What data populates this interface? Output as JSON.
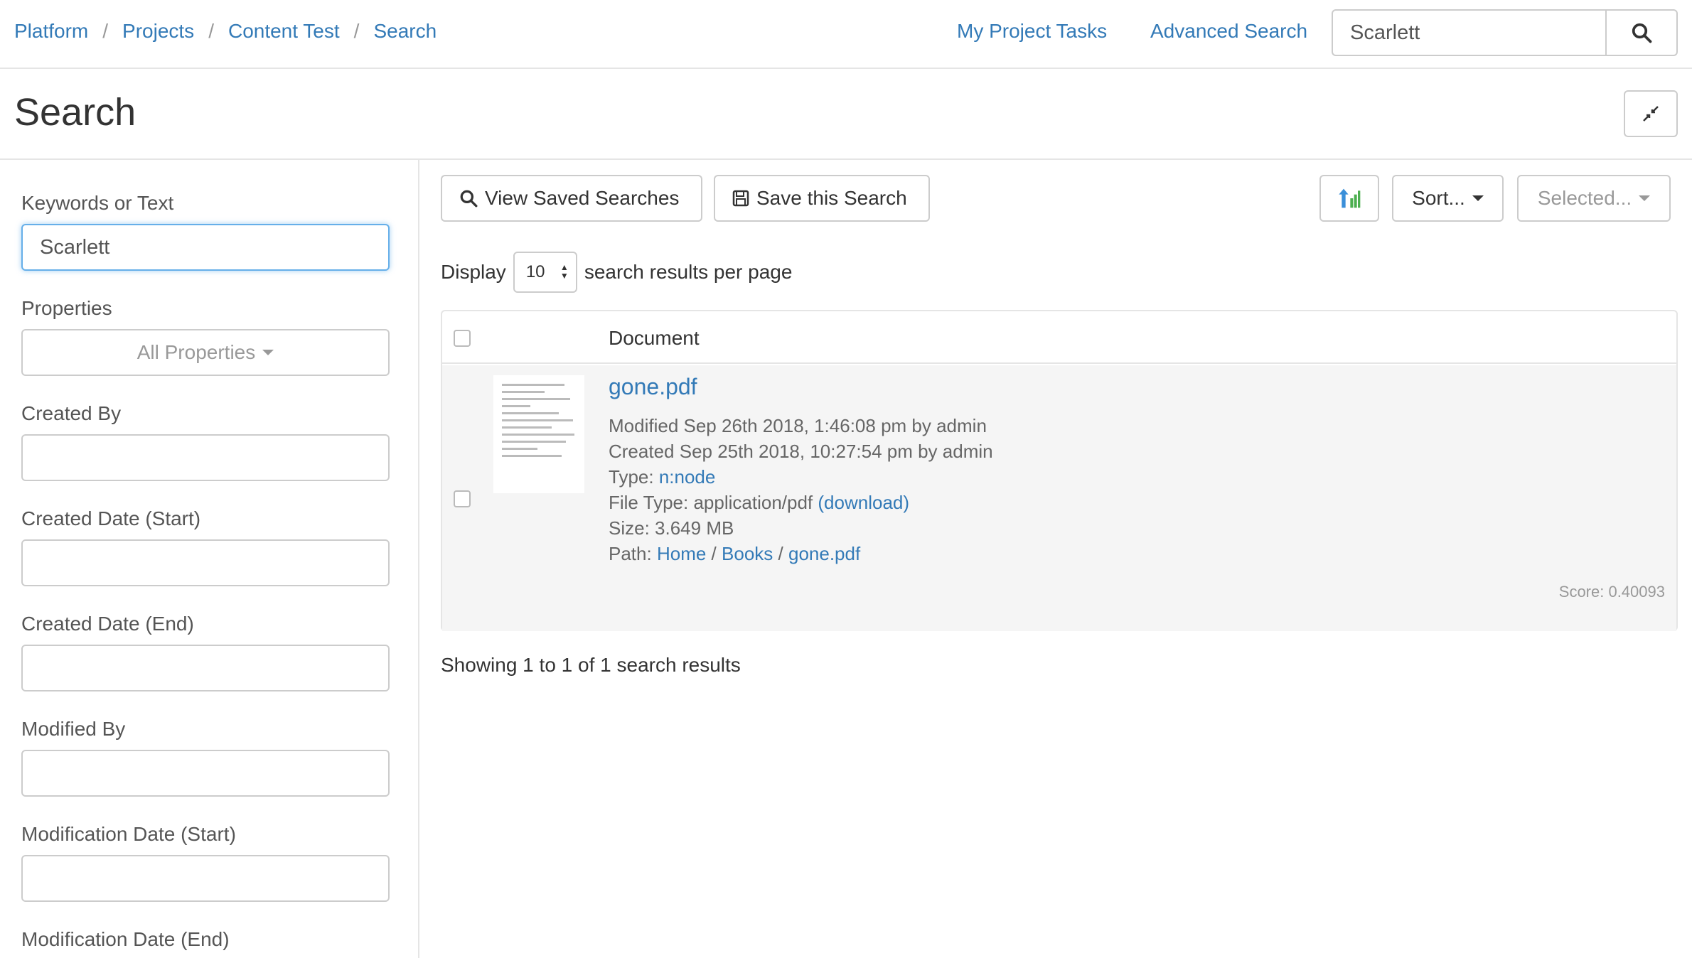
{
  "breadcrumb": [
    "Platform",
    "Projects",
    "Content Test",
    "Search"
  ],
  "topnav": {
    "my_tasks": "My Project Tasks",
    "advanced_search": "Advanced Search",
    "search_value": "Scarlett"
  },
  "page": {
    "title": "Search"
  },
  "sidebar": {
    "keywords_label": "Keywords or Text",
    "keywords_value": "Scarlett",
    "properties_label": "Properties",
    "properties_value": "All Properties",
    "created_by_label": "Created By",
    "created_start_label": "Created Date (Start)",
    "created_end_label": "Created Date (End)",
    "modified_by_label": "Modified By",
    "mod_start_label": "Modification Date (Start)",
    "mod_end_label": "Modification Date (End)"
  },
  "toolbar": {
    "view_saved": "View Saved Searches",
    "save_search": "Save this Search",
    "sort": "Sort...",
    "selected": "Selected..."
  },
  "display": {
    "prefix": "Display",
    "per_page": "10",
    "suffix": "search results per page"
  },
  "results": {
    "column_header": "Document",
    "items": [
      {
        "title": "gone.pdf",
        "modified": "Modified Sep 26th 2018, 1:46:08 pm by admin",
        "created": "Created Sep 25th 2018, 10:27:54 pm by admin",
        "type_label": "Type:",
        "type_value": "n:node",
        "file_type_label": "File Type: application/pdf",
        "download_label": "(download)",
        "size": "Size: 3.649 MB",
        "path_label": "Path:",
        "path": [
          "Home",
          "Books",
          "gone.pdf"
        ],
        "score": "Score: 0.40093"
      }
    ],
    "summary": "Showing 1 to 1 of 1 search results"
  },
  "colors": {
    "link": "#337ab7",
    "border": "#cccccc",
    "row_bg": "#f5f5f5"
  },
  "icons": [
    "search-icon",
    "collapse-icon",
    "save-icon",
    "sort-direction-icon",
    "caret-down-icon"
  ]
}
